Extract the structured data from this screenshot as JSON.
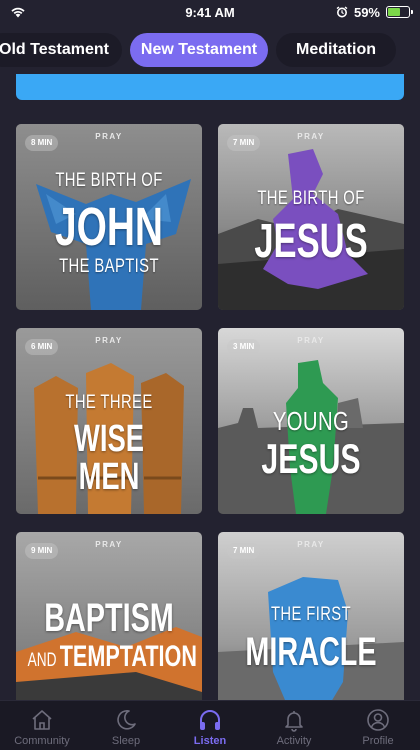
{
  "status": {
    "time": "9:41 AM",
    "battery": "59%",
    "battery_level": 0.59,
    "icons": [
      "wifi-icon",
      "alarm-icon",
      "battery-icon"
    ]
  },
  "tabs": [
    {
      "label": "Old Testament",
      "active": false
    },
    {
      "label": "New Testament",
      "active": true
    },
    {
      "label": "Meditation",
      "active": false
    }
  ],
  "colors": {
    "background": "#232230",
    "accent": "#7b6cf0",
    "banner": "#3aa8f5",
    "nav_inactive": "#6e6d7c"
  },
  "cards": [
    {
      "duration": "8 MIN",
      "category": "PRAY",
      "line1": "THE BIRTH OF",
      "line2": "JOHN",
      "line3": "THE BAPTIST"
    },
    {
      "duration": "7 MIN",
      "category": "PRAY",
      "line1": "THE BIRTH OF",
      "line2": "JESUS"
    },
    {
      "duration": "6 MIN",
      "category": "PRAY",
      "line1": "THE THREE",
      "line2": "WISE MEN"
    },
    {
      "duration": "3 MIN",
      "category": "PRAY",
      "line1": "YOUNG",
      "line2": "JESUS"
    },
    {
      "duration": "9 MIN",
      "category": "PRAY",
      "line1": "BAPTISM",
      "line2a": "AND",
      "line2b": "TEMPTATION"
    },
    {
      "duration": "7 MIN",
      "category": "PRAY",
      "line1": "THE FIRST",
      "line2": "MIRACLE"
    }
  ],
  "nav": [
    {
      "label": "Community",
      "icon": "home-icon",
      "active": false
    },
    {
      "label": "Sleep",
      "icon": "moon-icon",
      "active": false
    },
    {
      "label": "Listen",
      "icon": "headphones-icon",
      "active": true
    },
    {
      "label": "Activity",
      "icon": "bell-icon",
      "active": false
    },
    {
      "label": "Profile",
      "icon": "person-icon",
      "active": false
    }
  ]
}
